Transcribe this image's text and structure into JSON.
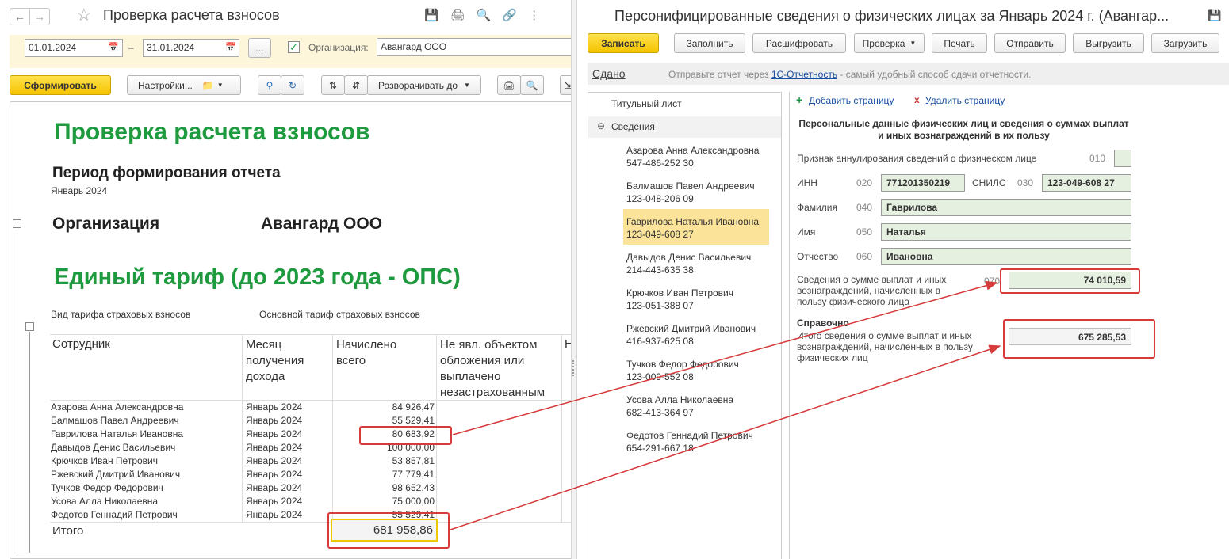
{
  "left": {
    "title": "Проверка расчета взносов",
    "date_from": "01.01.2024",
    "date_sep": "–",
    "date_to": "31.01.2024",
    "more_btn": "...",
    "org_label": "Организация:",
    "org_value": "Авангард ООО",
    "form_btn": "Сформировать",
    "settings_btn": "Настройки...",
    "expand_btn": "Разворачивать до",
    "report": {
      "heading": "Проверка расчета взносов",
      "period_label": "Период формирования отчета",
      "period_value": "Январь 2024",
      "org_label": "Организация",
      "org_value": "Авангард ООО",
      "tariff_heading": "Единый тариф (до 2023 года - ОПС)",
      "tariff_type_label": "Вид тарифа страховых взносов",
      "tariff_type_value": "Основной тариф страховых взносов",
      "col_employee": "Сотрудник",
      "col_month": "Месяц получения дохода",
      "col_accrued": "Начислено всего",
      "col_not_object": "Не явл. объектом обложения или выплачено незастрахованным",
      "col_next": "Н",
      "rows": [
        {
          "name": "Азарова Анна Александровна",
          "month": "Январь 2024",
          "amount": "84 926,47"
        },
        {
          "name": "Балмашов Павел Андреевич",
          "month": "Январь 2024",
          "amount": "55 529,41"
        },
        {
          "name": "Гаврилова Наталья Ивановна",
          "month": "Январь 2024",
          "amount": "80 683,92"
        },
        {
          "name": "Давыдов Денис Васильевич",
          "month": "Январь 2024",
          "amount": "100 000,00"
        },
        {
          "name": "Крючков Иван Петрович",
          "month": "Январь 2024",
          "amount": "53 857,81"
        },
        {
          "name": "Ржевский Дмитрий Иванович",
          "month": "Январь 2024",
          "amount": "77 779,41"
        },
        {
          "name": "Тучков Федор Федорович",
          "month": "Январь 2024",
          "amount": "98 652,43"
        },
        {
          "name": "Усова Алла Николаевна",
          "month": "Январь 2024",
          "amount": "75 000,00"
        },
        {
          "name": "Федотов Геннадий Петрович",
          "month": "Январь 2024",
          "amount": "55 529,41"
        }
      ],
      "total_label": "Итого",
      "total_value": "681 958,86"
    }
  },
  "right": {
    "title": "Персонифицированные сведения о физических лицах за Январь 2024 г. (Авангар...",
    "buttons": {
      "save": "Записать",
      "fill": "Заполнить",
      "decode": "Расшифровать",
      "check": "Проверка",
      "print": "Печать",
      "send": "Отправить",
      "upload": "Выгрузить",
      "load": "Загрузить"
    },
    "status": "Сдано",
    "status_hint_pre": "Отправьте отчет через ",
    "status_hint_link": "1С-Отчетность",
    "status_hint_post": " - самый удобный способ сдачи отчетности.",
    "tree": {
      "title_page": "Титульный лист",
      "section": "Сведения",
      "employees": [
        {
          "name": "Азарова Анна Александровна",
          "snils": "547-486-252 30"
        },
        {
          "name": "Балмашов Павел Андреевич",
          "snils": "123-048-206 09"
        },
        {
          "name": "Гаврилова Наталья Ивановна",
          "snils": "123-049-608 27"
        },
        {
          "name": "Давыдов Денис Васильевич",
          "snils": "214-443-635 38"
        },
        {
          "name": "Крючков Иван Петрович",
          "snils": "123-051-388 07"
        },
        {
          "name": "Ржевский Дмитрий Иванович",
          "snils": "416-937-625 08"
        },
        {
          "name": "Тучков Федор Федорович",
          "snils": "123-009-552 08"
        },
        {
          "name": "Усова Алла Николаевна",
          "snils": "682-413-364 97"
        },
        {
          "name": "Федотов Геннадий Петрович",
          "snils": "654-291-667 18"
        }
      ]
    },
    "form": {
      "add_page": "Добавить страницу",
      "del_page": "Удалить страницу",
      "heading": "Персональные данные физических лиц и сведения о суммах выплат и иных вознаграждений в их пользу",
      "cancel_label": "Признак аннулирования сведений о физическом лице",
      "cancel_code": "010",
      "inn_label": "ИНН",
      "inn_code": "020",
      "inn_value": "771201350219",
      "snils_label": "СНИЛС",
      "snils_code": "030",
      "snils_value": "123-049-608 27",
      "surname_label": "Фамилия",
      "surname_code": "040",
      "surname_value": "Гаврилова",
      "name_label": "Имя",
      "name_code": "050",
      "name_value": "Наталья",
      "patronymic_label": "Отчество",
      "patronymic_code": "060",
      "patronymic_value": "Ивановна",
      "payments_label": "Сведения о сумме выплат и иных вознаграждений, начисленных в пользу физического лица",
      "payments_code": "070",
      "payments_value": "74 010,59",
      "ref_label": "Справочно",
      "total_label": "Итого сведения о сумме выплат и иных вознаграждений, начисленных в пользу физических лиц",
      "total_value": "675 285,53"
    }
  },
  "colors": {
    "yellow": "#f5c400",
    "green_heading": "#1e9b3e",
    "annotation_red": "#d63a3a",
    "link_blue": "#1a4fa0"
  }
}
